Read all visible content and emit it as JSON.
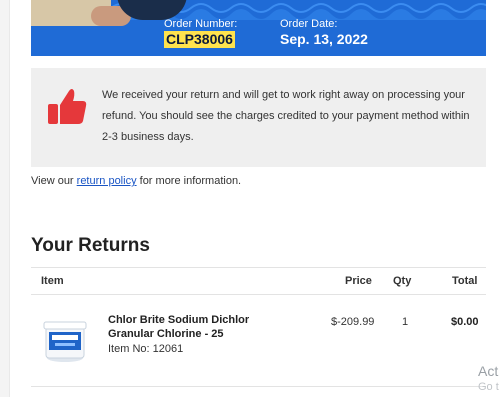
{
  "order": {
    "number_label": "Order Number:",
    "number": "CLP38006",
    "date_label": "Order Date:",
    "date": "Sep. 13, 2022"
  },
  "notice": {
    "icon": "thumbs-up-icon",
    "text": "We received your return and will get to work right away on processing your refund. You should see the charges credited to your payment method within 2-3 business days."
  },
  "policy": {
    "prefix": "View our ",
    "link": "return policy",
    "suffix": " for more information."
  },
  "returns": {
    "title": "Your Returns",
    "columns": {
      "item": "Item",
      "price": "Price",
      "qty": "Qty",
      "total": "Total"
    },
    "rows": [
      {
        "name": "Chlor Brite Sodium Dichlor Granular Chlorine - 25",
        "item_no": "Item No: 12061",
        "price": "$-209.99",
        "qty": "1",
        "total": "$0.00"
      }
    ]
  },
  "watermark": {
    "line1": "Act",
    "line2": "Go t"
  },
  "colors": {
    "hero": "#1f6bd6",
    "highlight": "#ffe34d",
    "accent": "#e5383b",
    "link": "#1a55c4"
  }
}
